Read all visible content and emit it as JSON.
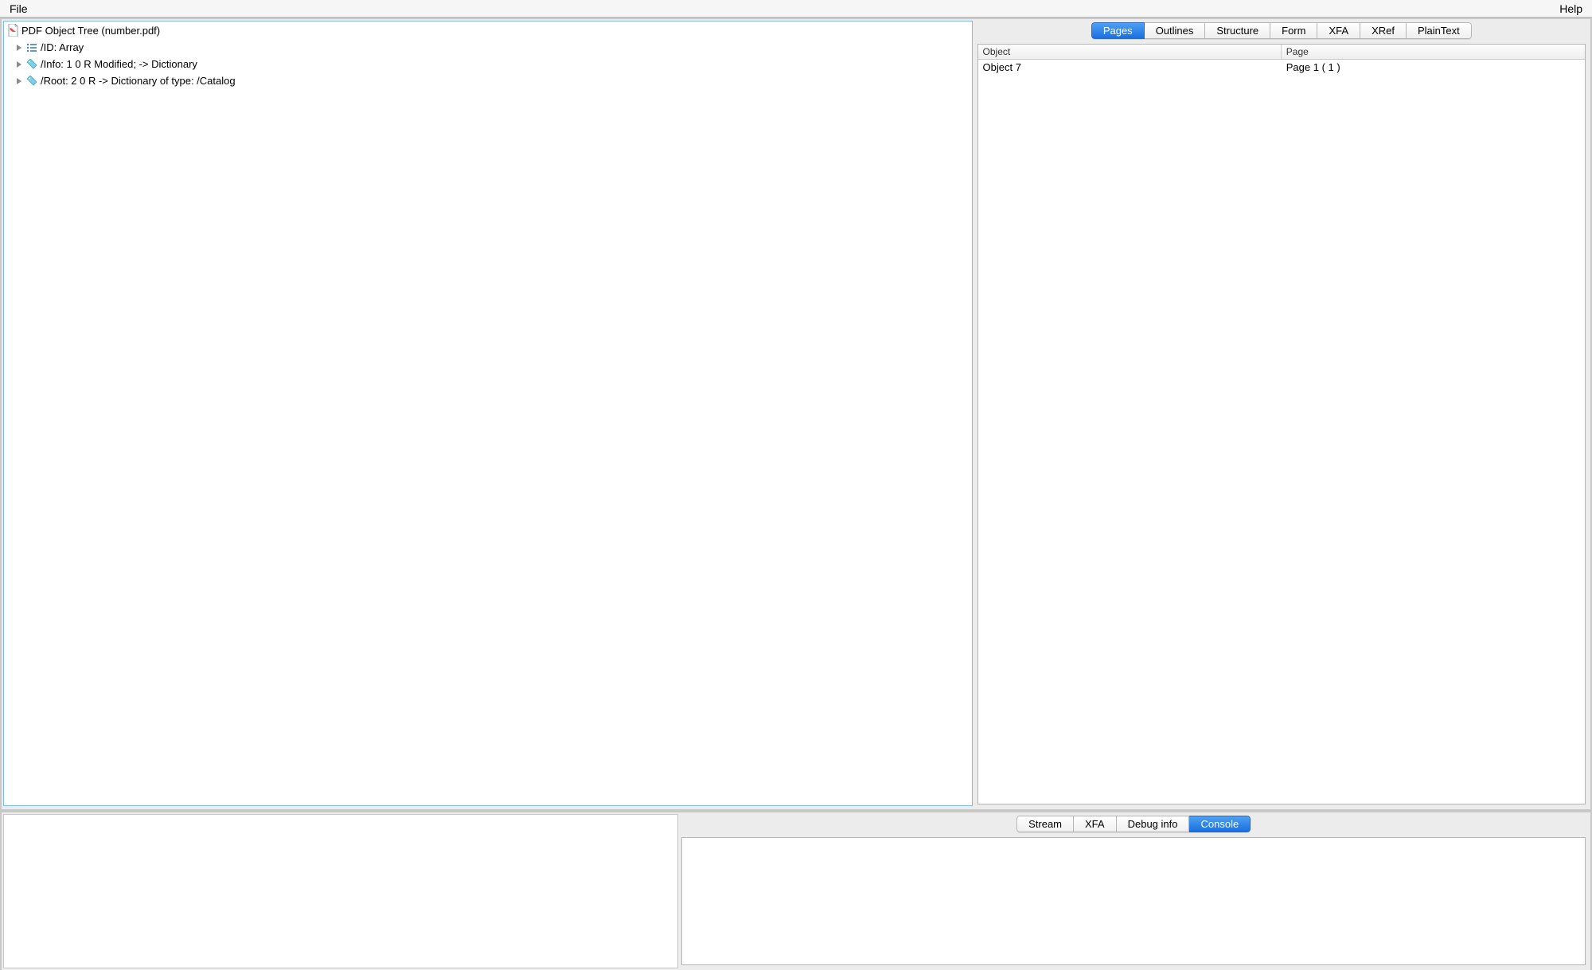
{
  "menubar": {
    "file": "File",
    "help": "Help"
  },
  "tree": {
    "root_label": "PDF Object Tree (number.pdf)",
    "children": [
      {
        "label": "/ID: Array",
        "icon": "list"
      },
      {
        "label": "/Info: 1 0 R Modified; -> Dictionary",
        "icon": "tag"
      },
      {
        "label": "/Root: 2 0 R -> Dictionary of type: /Catalog",
        "icon": "tag"
      }
    ]
  },
  "rightTabs": {
    "items": [
      "Pages",
      "Outlines",
      "Structure",
      "Form",
      "XFA",
      "XRef",
      "PlainText"
    ],
    "activeIndex": 0
  },
  "rightList": {
    "headers": {
      "object": "Object",
      "page": "Page"
    },
    "rows": [
      {
        "object": "Object 7",
        "page": "Page 1 ( 1 )"
      }
    ]
  },
  "bottomTabs": {
    "items": [
      "Stream",
      "XFA",
      "Debug info",
      "Console"
    ],
    "activeIndex": 3
  }
}
